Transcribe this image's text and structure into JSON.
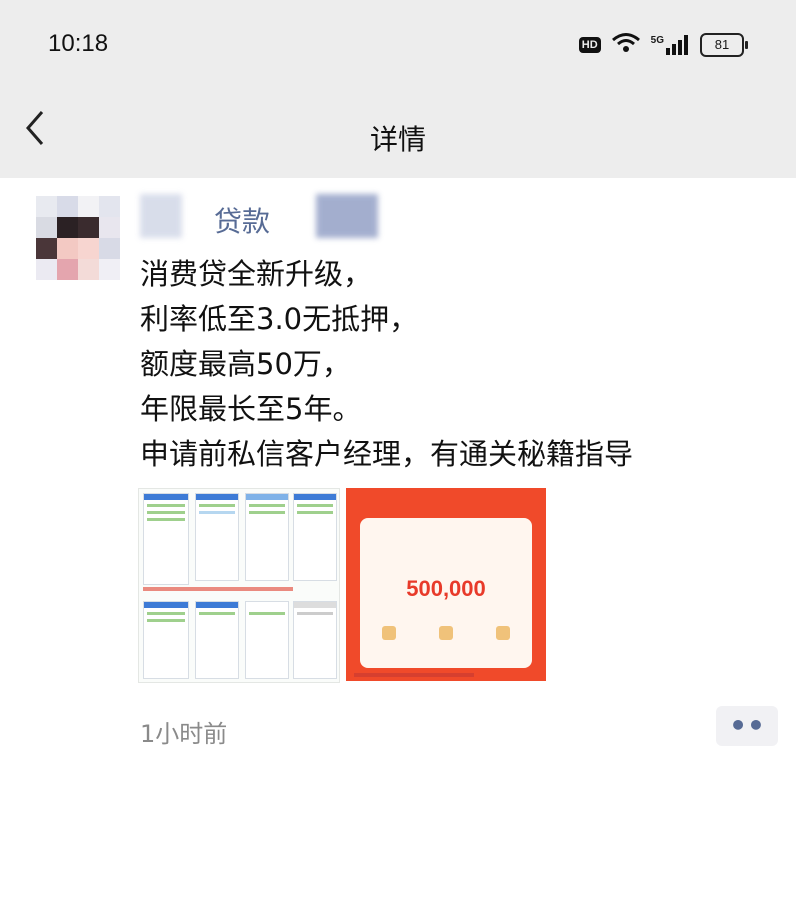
{
  "status_bar": {
    "time": "10:18",
    "network": "5G",
    "battery": "81",
    "icons": [
      "hd-icon",
      "wifi-icon",
      "signal-icon",
      "battery-icon"
    ]
  },
  "nav": {
    "back_icon": "chevron-left",
    "title": "详情"
  },
  "post": {
    "author_visible": "贷款",
    "text": "消费贷全新升级，\n利率低至3.0无抵押，\n额度最高50万，\n年限最长至5年。\n申请前私信客户经理，有通关秘籍指导",
    "images": [
      {
        "name": "screenshot-collage"
      },
      {
        "name": "loan-offer-card",
        "amount": "500,000"
      }
    ],
    "timestamp": "1小时前",
    "more_icon": "••"
  },
  "colors": {
    "link_blue": "#576b95",
    "header_bg": "#ededed",
    "promo_red": "#f04a2a"
  }
}
